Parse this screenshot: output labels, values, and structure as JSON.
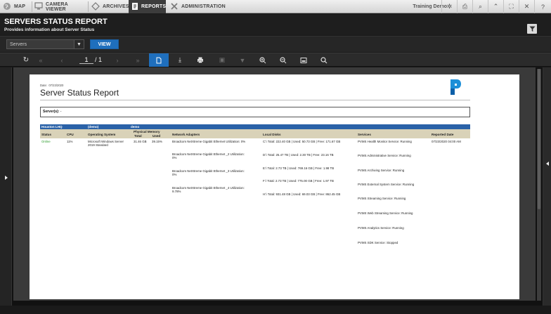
{
  "nav": {
    "map": "MAP",
    "camera_viewer": "CAMERA VIEWER",
    "archives": "ARCHIVES",
    "reports": "REPORTS",
    "administration": "ADMINISTRATION",
    "training_demo": "Training Demo"
  },
  "header": {
    "title": "SERVERS STATUS REPORT",
    "subtitle": "Provides information about Server Status"
  },
  "selector": {
    "selected": "Servers",
    "view_button": "VIEW"
  },
  "pager": {
    "current": "1",
    "total": "/ 1"
  },
  "report": {
    "date_label": "Date:",
    "date_value": "07/23/2020",
    "title": "Server Status Report",
    "servers_label": "Server(s):",
    "servers_value": "-",
    "group_name": "Houston LHQ",
    "group_demo1": "(demo)",
    "group_demo2": "demo",
    "columns": {
      "status": "Status",
      "cpu": "CPU",
      "os": "Operating System",
      "physical_memory": "Physical Memory",
      "pm_total": "Total",
      "pm_used": "Used",
      "network": "Network Adapters",
      "disks": "Local Disks",
      "services": "Services",
      "reported": "Reported Date"
    },
    "row": {
      "status": "Online",
      "cpu": "11%",
      "os_line1": "Microsoft Windows Server",
      "os_line2": "2019 Standard",
      "mem_total": "31.46 GB",
      "mem_used": "39.15%",
      "reported": "07/23/2020 04:00 AM"
    },
    "network": [
      {
        "line1": "Broadcom NetXtreme Gigabit Ethernet Utilization: 0%",
        "line2": ""
      },
      {
        "line1": "Broadcom NetXtreme Gigabit Ethernet _2 Utilization:",
        "line2": "0%"
      },
      {
        "line1": "Broadcom NetXtreme Gigabit Ethernet _3 Utilization:",
        "line2": "0%"
      },
      {
        "line1": "Broadcom NetXtreme Gigabit Ethernet _4 Utilization:",
        "line2": "9.78%"
      }
    ],
    "disks": [
      "C:\\ Total: 222.40 GB | Used: 50.73 GB | Free: 171.67 GB",
      "D:\\ Total: 25.47 TB | Used: 2.30 TB | Free: 23.16 TB",
      "E:\\ Total: 2.73 TB | Used: 769.16 GB | Free: 1.98 TB",
      "F:\\ Total: 2.73 TB | Used: 775.00 GB | Free: 1.97 TB",
      "H:\\ Total: 931.48 GB | Used: 69.03 GB | Free: 862.45 GB"
    ],
    "services": [
      "PVMS Health Monitor Service: Running",
      "PVMS Administrative Service: Running",
      "PVMS Archiving Service: Running",
      "PVMS External System Service: Running",
      "PVMS Streaming Service: Running",
      "PVMS Web Streaming Service: Running",
      "PVMS Analytics Service: Running",
      "PVMS SDK Service: Stopped"
    ]
  },
  "colors": {
    "accent": "#1f6fbd",
    "group_header": "#2a62a8",
    "column_header": "#d9d2b8",
    "online": "#2a9a2a"
  }
}
